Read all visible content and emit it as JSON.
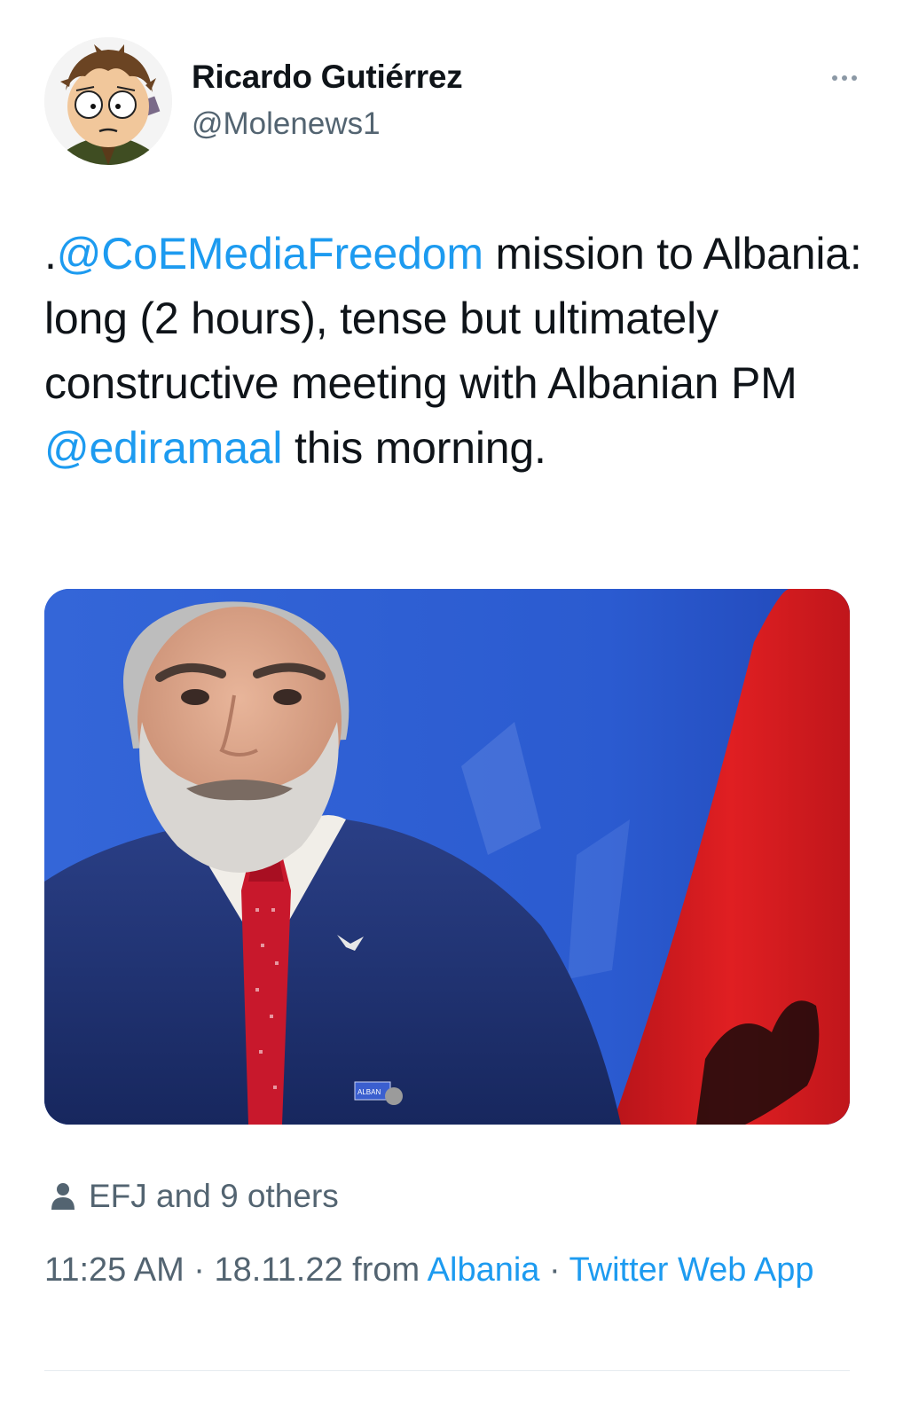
{
  "author": {
    "name": "Ricardo Gutiérrez",
    "handle": "@Molenews1"
  },
  "tweet": {
    "prefix": ".",
    "mention_1": "@CoEMediaFreedom",
    "text_1": " mission to Albania: long (2 hours), tense but ultimately constructive meeting with Albanian PM ",
    "mention_2": "@ediramaal",
    "text_2": " this morning."
  },
  "media": {
    "badge_text": "ALBAN"
  },
  "likers": {
    "text": "EFJ and 9 others"
  },
  "meta": {
    "time": "11:25 AM",
    "sep_1": " · ",
    "date": "18.11.22",
    "from_word": " from ",
    "location": "Albania",
    "sep_2": " · ",
    "source": "Twitter Web App"
  },
  "colors": {
    "link": "#1d9bf0",
    "secondary_text": "#536471",
    "primary_text": "#0f1419",
    "photo_background": "#2a54c9",
    "flag_red": "#d3171a"
  },
  "icons": {
    "more": "more-horizontal-icon",
    "likers": "person-icon"
  }
}
